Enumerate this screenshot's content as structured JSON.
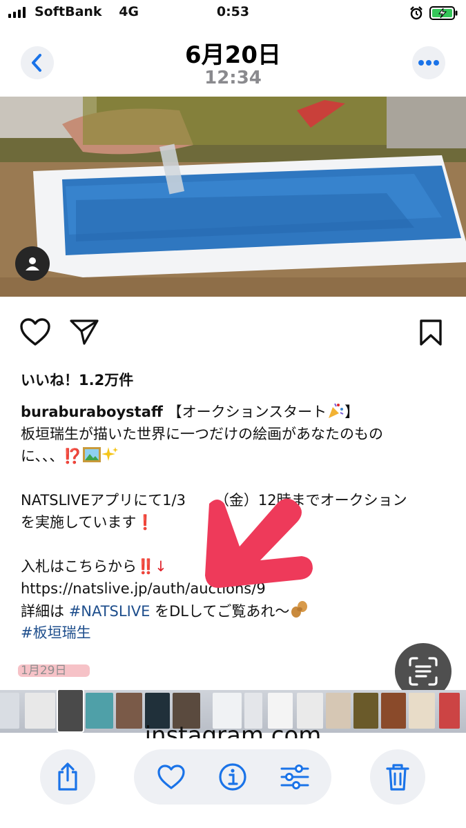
{
  "status_bar": {
    "carrier": "SoftBank",
    "network": "4G",
    "time": "0:53",
    "battery_color": "#34c759"
  },
  "photos_header": {
    "date": "6月20日",
    "time": "12:34",
    "accent": "#1a73e8"
  },
  "post": {
    "likes": "いいね！1.2万件",
    "username": "buraburaboystaff",
    "caption_line1_rest": "【オークションスタート",
    "caption_line1_end": "】",
    "caption_line2": "板垣瑞生が描いた世界に一つだけの絵画があなたのもの",
    "caption_line3": "に、、、",
    "caption_line3_mark": "⁉️",
    "caption_line5": "NATSLIVEアプリにて1/3",
    "caption_line5_end": "（金）12時までオークション",
    "caption_line6": "を実施しています",
    "caption_line6_mark": "❗",
    "caption_line8": "入札はこちらから",
    "caption_line8_mark": "‼️↓",
    "caption_line9": "https://natslive.jp/auth/auctions/9",
    "caption_line10_a": "詳細は ",
    "caption_line10_tag": "#NATSLIVE",
    "caption_line10_b": " をDLしてご覧あれ〜",
    "caption_line11_tag": "#板垣瑞生",
    "post_date": "1月29日",
    "hashtag_color": "#1e4e8c"
  },
  "url_bar": {
    "domain": "instagram.com"
  },
  "icons": {
    "back": "chevron-left-icon",
    "more": "ellipsis-icon",
    "like": "heart-outline-icon",
    "share": "paper-plane-icon",
    "bookmark": "bookmark-icon",
    "live_text": "live-text-icon",
    "toolbar_share": "share-icon",
    "toolbar_favorite": "heart-icon",
    "toolbar_info": "info-icon",
    "toolbar_adjust": "sliders-icon",
    "toolbar_delete": "trash-icon"
  }
}
